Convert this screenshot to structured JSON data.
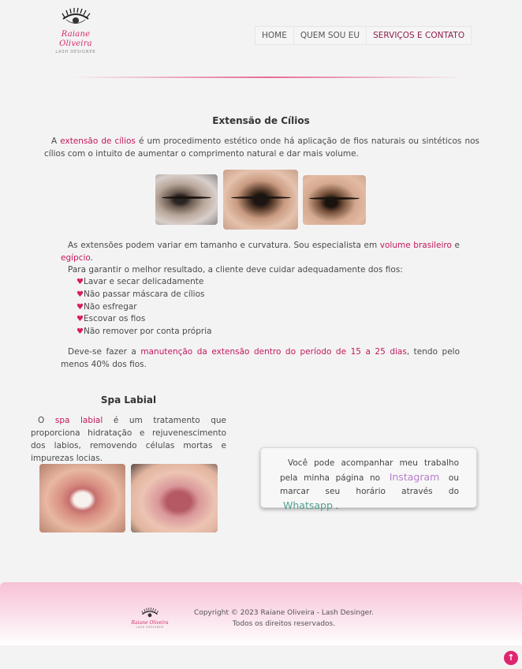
{
  "brand": {
    "name": "Raiane Oliveira",
    "tagline": "LASH DESIGNER"
  },
  "nav": {
    "items": [
      "HOME",
      "QUEM SOU EU",
      "SERVIÇOS E CONTATO"
    ]
  },
  "cilios": {
    "title": "Extensão de Cílios",
    "intro_lead": "A ",
    "intro_highlight": "extensão de cílios",
    "intro_rest": " é um procedimento estético onde há aplicação de fios naturais ou sintéticos nos cílios com o intuito de aumentar o comprimento natural e dar mais volume.",
    "variation_lead": "As extensões podem variar em tamanho e curvatura. Sou especialista em ",
    "variation_hl1": "volume brasileiro",
    "variation_mid": " e ",
    "variation_hl2": "egípcio",
    "variation_end": ".",
    "care_intro": "Para garantir o melhor resultado, a cliente deve cuidar adequadamente dos fios:",
    "care_items": [
      "Lavar e secar delicadamente",
      "Não passar máscara de cílios",
      "Não esfregar",
      "Escovar os fios",
      "Não remover por conta própria"
    ],
    "maint_lead": "Deve-se fazer a ",
    "maint_highlight": "manutenção da extensão dentro do período de 15 a 25 dias",
    "maint_rest": ", tendo pelo menos 40% dos fios."
  },
  "spa": {
    "title": "Spa Labial",
    "lead": "O ",
    "highlight": "spa labial",
    "rest": " é um tratamento que proporciona hidratação e rejuvenescimento dos labios, removendo células mortas e impurezas locias."
  },
  "contact": {
    "text1": "Você pode acompanhar meu trabalho pela minha página no ",
    "instagram": "Instagram",
    "text2": " ou marcar seu horário através do ",
    "whatsapp": "Whatsapp",
    "text3": "."
  },
  "footer": {
    "copyright": "Copyright © 2023 Raiane Oliveira - Lash Desinger.",
    "rights": "Todos os direitos reservados."
  },
  "back_to_top": "↑"
}
